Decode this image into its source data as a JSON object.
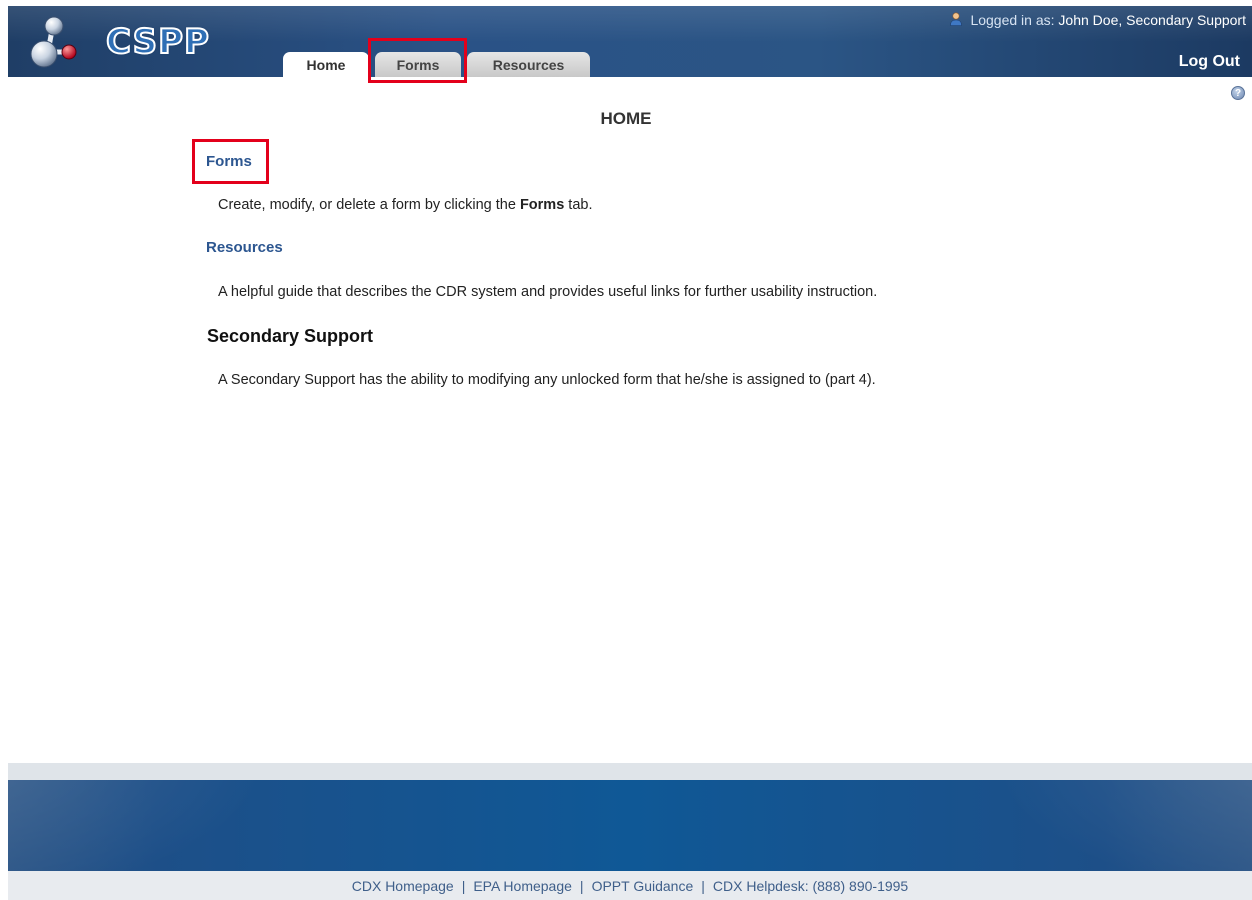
{
  "header": {
    "logo_text": "CSPP",
    "login_prefix": "Logged in as:",
    "user_name": "John Doe, Secondary Support",
    "logout_label": "Log Out"
  },
  "tabs": [
    {
      "label": "Home",
      "active": true
    },
    {
      "label": "Forms",
      "active": false
    },
    {
      "label": "Resources",
      "active": false
    }
  ],
  "help_icon": "?",
  "main": {
    "title": "HOME",
    "sections": [
      {
        "heading": "Forms",
        "text_before": "Create, modify, or delete a form by clicking the ",
        "text_bold": "Forms",
        "text_after": " tab."
      },
      {
        "heading": "Resources",
        "text": "A helpful guide that describes the CDR system and provides useful links for further usability instruction."
      },
      {
        "heading": "Secondary Support",
        "text": "A Secondary Support has the ability to modifying any unlocked form that he/she is assigned to (part 4)."
      }
    ]
  },
  "footer": {
    "links": [
      "CDX Homepage",
      "EPA Homepage",
      "OPPT Guidance",
      "CDX Helpdesk: (888) 890-1995"
    ],
    "separator": "|"
  },
  "colors": {
    "header_blue": "#2a5286",
    "link_blue": "#2c5690",
    "highlight_red": "#e3001b"
  },
  "icons": {
    "logo": "molecule-icon",
    "user": "user-icon",
    "help": "help-icon"
  }
}
